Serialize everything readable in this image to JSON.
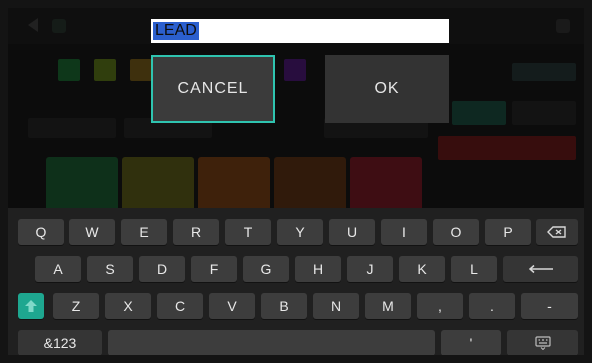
{
  "dialog": {
    "name_value": "LEAD",
    "cancel_label": "CANCEL",
    "ok_label": "OK"
  },
  "colors": {
    "accent": "#2fc4b0",
    "selection": "#2b5fce",
    "shift_key": "#1ea790"
  },
  "keyboard": {
    "row1": [
      "Q",
      "W",
      "E",
      "R",
      "T",
      "Y",
      "U",
      "I",
      "O",
      "P"
    ],
    "row2": [
      "A",
      "S",
      "D",
      "F",
      "G",
      "H",
      "J",
      "K",
      "L"
    ],
    "row3": [
      "Z",
      "X",
      "C",
      "V",
      "B",
      "N",
      "M",
      ",",
      ".",
      " -"
    ],
    "numbers_label": "&123",
    "apostrophe": "'",
    "icons": {
      "backspace": "backspace-icon",
      "enter": "enter-icon",
      "shift": "shift-icon",
      "keyboard": "keyboard-icon"
    }
  }
}
